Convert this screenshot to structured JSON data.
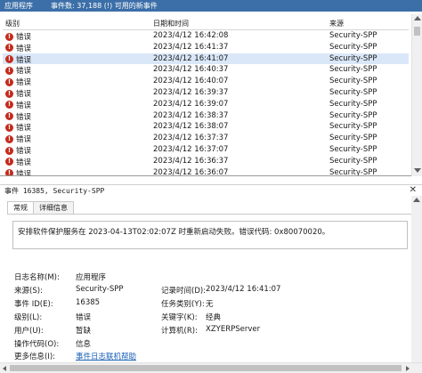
{
  "header": {
    "log_name": "应用程序",
    "event_count": "事件数: 37,188 (!) 可用的新事件"
  },
  "grid": {
    "columns": [
      "级别",
      "日期和时间",
      "来源"
    ],
    "rows": [
      {
        "level": "错误",
        "datetime": "2023/4/12 16:42:08",
        "source": "Security-SPP"
      },
      {
        "level": "错误",
        "datetime": "2023/4/12 16:41:37",
        "source": "Security-SPP"
      },
      {
        "level": "错误",
        "datetime": "2023/4/12 16:41:07",
        "source": "Security-SPP"
      },
      {
        "level": "错误",
        "datetime": "2023/4/12 16:40:37",
        "source": "Security-SPP"
      },
      {
        "level": "错误",
        "datetime": "2023/4/12 16:40:07",
        "source": "Security-SPP"
      },
      {
        "level": "错误",
        "datetime": "2023/4/12 16:39:37",
        "source": "Security-SPP"
      },
      {
        "level": "错误",
        "datetime": "2023/4/12 16:39:07",
        "source": "Security-SPP"
      },
      {
        "level": "错误",
        "datetime": "2023/4/12 16:38:37",
        "source": "Security-SPP"
      },
      {
        "level": "错误",
        "datetime": "2023/4/12 16:38:07",
        "source": "Security-SPP"
      },
      {
        "level": "错误",
        "datetime": "2023/4/12 16:37:37",
        "source": "Security-SPP"
      },
      {
        "level": "错误",
        "datetime": "2023/4/12 16:37:07",
        "source": "Security-SPP"
      },
      {
        "level": "错误",
        "datetime": "2023/4/12 16:36:37",
        "source": "Security-SPP"
      },
      {
        "level": "错误",
        "datetime": "2023/4/12 16:36:07",
        "source": "Security-SPP"
      }
    ]
  },
  "detail": {
    "title": "事件 16385, Security-SPP",
    "tabs": [
      "常规",
      "详细信息"
    ],
    "description": "安排软件保护服务在 2023-04-13T02:02:07Z 时重新启动失败。错误代码: 0x80070020。",
    "fields": {
      "log_name_label": "日志名称(M):",
      "log_name_value": "应用程序",
      "source_label": "来源(S):",
      "source_value": "Security-SPP",
      "logged_label": "记录时间(D):",
      "logged_value": "2023/4/12 16:41:07",
      "event_id_label": "事件 ID(E):",
      "event_id_value": "16385",
      "task_label": "任务类别(Y):",
      "task_value": "无",
      "level_label": "级别(L):",
      "level_value": "错误",
      "keywords_label": "关键字(K):",
      "keywords_value": "经典",
      "user_label": "用户(U):",
      "user_value": "暂缺",
      "computer_label": "计算机(R):",
      "computer_value": "XZYERPServer",
      "opcode_label": "操作代码(O):",
      "opcode_value": "信息",
      "more_info_label": "更多信息(I):",
      "more_info_link": "事件日志联机帮助"
    }
  },
  "colors": {
    "title_bar": "#3c6fa8",
    "selected_row": "#d9e7f8",
    "error_icon": "#c42b1c",
    "link": "#1a5fb4"
  },
  "icons": {
    "error": "error-icon"
  }
}
